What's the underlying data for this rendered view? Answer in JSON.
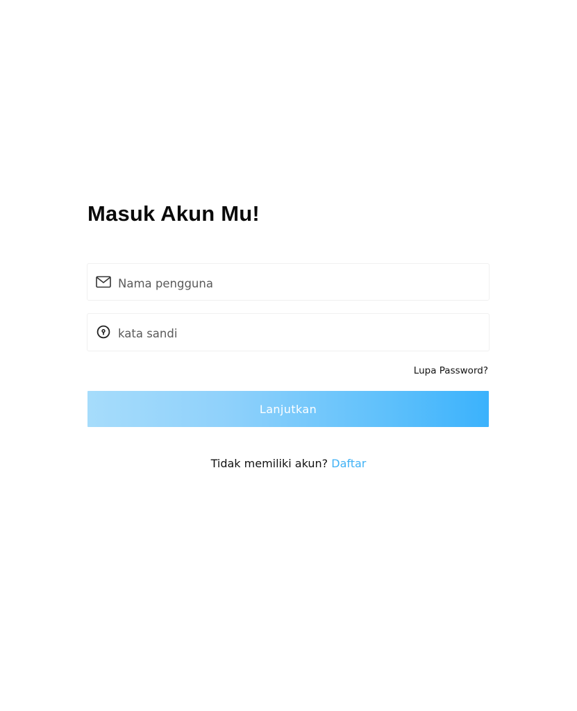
{
  "login": {
    "title": "Masuk Akun Mu!",
    "username": {
      "placeholder": "Nama pengguna",
      "value": "",
      "icon": "mail-icon"
    },
    "password": {
      "placeholder": "kata sandi",
      "value": "",
      "icon": "keyhole-icon"
    },
    "forgot_label": "Lupa Password?",
    "submit_label": "Lanjutkan",
    "signup_prompt": "Tidak memiliki akun?",
    "signup_link": "Daftar"
  },
  "colors": {
    "accent": "#3bb2fc",
    "button_gradient_start": "#a6dcfb",
    "button_gradient_end": "#3bb2fc",
    "link": "#3fb1f5",
    "text": "#0a0a0a"
  }
}
